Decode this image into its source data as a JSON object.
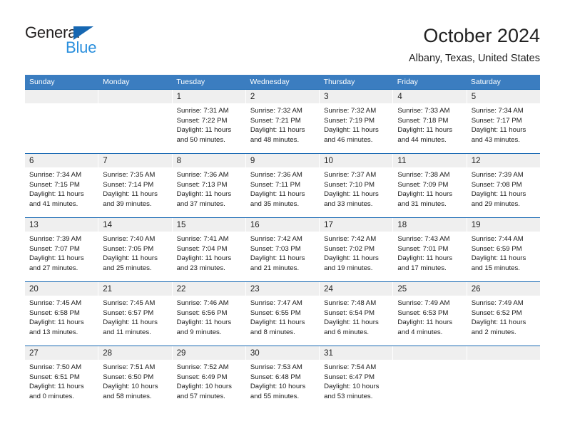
{
  "brand": {
    "word_one": "General",
    "word_two": "Blue",
    "accent_color": "#1667b2",
    "light_blue": "#2a8fdd"
  },
  "header": {
    "month_title": "October 2024",
    "location": "Albany, Texas, United States"
  },
  "theme": {
    "header_row_bg": "#3b7dc0",
    "week_border": "#1667b2",
    "day_band_bg": "#efefef"
  },
  "weekdays": [
    "Sunday",
    "Monday",
    "Tuesday",
    "Wednesday",
    "Thursday",
    "Friday",
    "Saturday"
  ],
  "weeks": [
    [
      {
        "empty": true
      },
      {
        "empty": true
      },
      {
        "day": "1",
        "sunrise": "Sunrise: 7:31 AM",
        "sunset": "Sunset: 7:22 PM",
        "daylight1": "Daylight: 11 hours",
        "daylight2": "and 50 minutes."
      },
      {
        "day": "2",
        "sunrise": "Sunrise: 7:32 AM",
        "sunset": "Sunset: 7:21 PM",
        "daylight1": "Daylight: 11 hours",
        "daylight2": "and 48 minutes."
      },
      {
        "day": "3",
        "sunrise": "Sunrise: 7:32 AM",
        "sunset": "Sunset: 7:19 PM",
        "daylight1": "Daylight: 11 hours",
        "daylight2": "and 46 minutes."
      },
      {
        "day": "4",
        "sunrise": "Sunrise: 7:33 AM",
        "sunset": "Sunset: 7:18 PM",
        "daylight1": "Daylight: 11 hours",
        "daylight2": "and 44 minutes."
      },
      {
        "day": "5",
        "sunrise": "Sunrise: 7:34 AM",
        "sunset": "Sunset: 7:17 PM",
        "daylight1": "Daylight: 11 hours",
        "daylight2": "and 43 minutes."
      }
    ],
    [
      {
        "day": "6",
        "sunrise": "Sunrise: 7:34 AM",
        "sunset": "Sunset: 7:15 PM",
        "daylight1": "Daylight: 11 hours",
        "daylight2": "and 41 minutes."
      },
      {
        "day": "7",
        "sunrise": "Sunrise: 7:35 AM",
        "sunset": "Sunset: 7:14 PM",
        "daylight1": "Daylight: 11 hours",
        "daylight2": "and 39 minutes."
      },
      {
        "day": "8",
        "sunrise": "Sunrise: 7:36 AM",
        "sunset": "Sunset: 7:13 PM",
        "daylight1": "Daylight: 11 hours",
        "daylight2": "and 37 minutes."
      },
      {
        "day": "9",
        "sunrise": "Sunrise: 7:36 AM",
        "sunset": "Sunset: 7:11 PM",
        "daylight1": "Daylight: 11 hours",
        "daylight2": "and 35 minutes."
      },
      {
        "day": "10",
        "sunrise": "Sunrise: 7:37 AM",
        "sunset": "Sunset: 7:10 PM",
        "daylight1": "Daylight: 11 hours",
        "daylight2": "and 33 minutes."
      },
      {
        "day": "11",
        "sunrise": "Sunrise: 7:38 AM",
        "sunset": "Sunset: 7:09 PM",
        "daylight1": "Daylight: 11 hours",
        "daylight2": "and 31 minutes."
      },
      {
        "day": "12",
        "sunrise": "Sunrise: 7:39 AM",
        "sunset": "Sunset: 7:08 PM",
        "daylight1": "Daylight: 11 hours",
        "daylight2": "and 29 minutes."
      }
    ],
    [
      {
        "day": "13",
        "sunrise": "Sunrise: 7:39 AM",
        "sunset": "Sunset: 7:07 PM",
        "daylight1": "Daylight: 11 hours",
        "daylight2": "and 27 minutes."
      },
      {
        "day": "14",
        "sunrise": "Sunrise: 7:40 AM",
        "sunset": "Sunset: 7:05 PM",
        "daylight1": "Daylight: 11 hours",
        "daylight2": "and 25 minutes."
      },
      {
        "day": "15",
        "sunrise": "Sunrise: 7:41 AM",
        "sunset": "Sunset: 7:04 PM",
        "daylight1": "Daylight: 11 hours",
        "daylight2": "and 23 minutes."
      },
      {
        "day": "16",
        "sunrise": "Sunrise: 7:42 AM",
        "sunset": "Sunset: 7:03 PM",
        "daylight1": "Daylight: 11 hours",
        "daylight2": "and 21 minutes."
      },
      {
        "day": "17",
        "sunrise": "Sunrise: 7:42 AM",
        "sunset": "Sunset: 7:02 PM",
        "daylight1": "Daylight: 11 hours",
        "daylight2": "and 19 minutes."
      },
      {
        "day": "18",
        "sunrise": "Sunrise: 7:43 AM",
        "sunset": "Sunset: 7:01 PM",
        "daylight1": "Daylight: 11 hours",
        "daylight2": "and 17 minutes."
      },
      {
        "day": "19",
        "sunrise": "Sunrise: 7:44 AM",
        "sunset": "Sunset: 6:59 PM",
        "daylight1": "Daylight: 11 hours",
        "daylight2": "and 15 minutes."
      }
    ],
    [
      {
        "day": "20",
        "sunrise": "Sunrise: 7:45 AM",
        "sunset": "Sunset: 6:58 PM",
        "daylight1": "Daylight: 11 hours",
        "daylight2": "and 13 minutes."
      },
      {
        "day": "21",
        "sunrise": "Sunrise: 7:45 AM",
        "sunset": "Sunset: 6:57 PM",
        "daylight1": "Daylight: 11 hours",
        "daylight2": "and 11 minutes."
      },
      {
        "day": "22",
        "sunrise": "Sunrise: 7:46 AM",
        "sunset": "Sunset: 6:56 PM",
        "daylight1": "Daylight: 11 hours",
        "daylight2": "and 9 minutes."
      },
      {
        "day": "23",
        "sunrise": "Sunrise: 7:47 AM",
        "sunset": "Sunset: 6:55 PM",
        "daylight1": "Daylight: 11 hours",
        "daylight2": "and 8 minutes."
      },
      {
        "day": "24",
        "sunrise": "Sunrise: 7:48 AM",
        "sunset": "Sunset: 6:54 PM",
        "daylight1": "Daylight: 11 hours",
        "daylight2": "and 6 minutes."
      },
      {
        "day": "25",
        "sunrise": "Sunrise: 7:49 AM",
        "sunset": "Sunset: 6:53 PM",
        "daylight1": "Daylight: 11 hours",
        "daylight2": "and 4 minutes."
      },
      {
        "day": "26",
        "sunrise": "Sunrise: 7:49 AM",
        "sunset": "Sunset: 6:52 PM",
        "daylight1": "Daylight: 11 hours",
        "daylight2": "and 2 minutes."
      }
    ],
    [
      {
        "day": "27",
        "sunrise": "Sunrise: 7:50 AM",
        "sunset": "Sunset: 6:51 PM",
        "daylight1": "Daylight: 11 hours",
        "daylight2": "and 0 minutes."
      },
      {
        "day": "28",
        "sunrise": "Sunrise: 7:51 AM",
        "sunset": "Sunset: 6:50 PM",
        "daylight1": "Daylight: 10 hours",
        "daylight2": "and 58 minutes."
      },
      {
        "day": "29",
        "sunrise": "Sunrise: 7:52 AM",
        "sunset": "Sunset: 6:49 PM",
        "daylight1": "Daylight: 10 hours",
        "daylight2": "and 57 minutes."
      },
      {
        "day": "30",
        "sunrise": "Sunrise: 7:53 AM",
        "sunset": "Sunset: 6:48 PM",
        "daylight1": "Daylight: 10 hours",
        "daylight2": "and 55 minutes."
      },
      {
        "day": "31",
        "sunrise": "Sunrise: 7:54 AM",
        "sunset": "Sunset: 6:47 PM",
        "daylight1": "Daylight: 10 hours",
        "daylight2": "and 53 minutes."
      },
      {
        "empty": true
      },
      {
        "empty": true
      }
    ]
  ]
}
